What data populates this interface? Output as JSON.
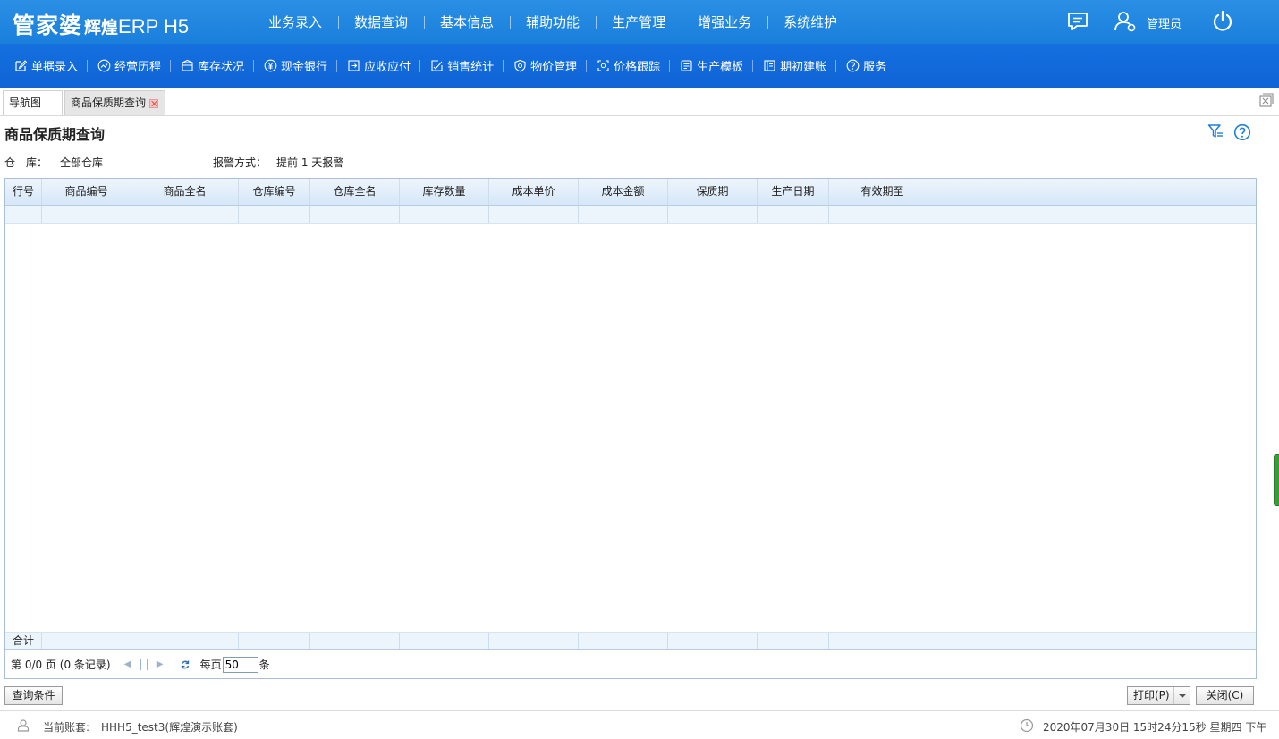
{
  "header": {
    "logo_main": "管家婆",
    "logo_sub": "辉煌",
    "logo_erp": "ERP H5",
    "nav": [
      "业务录入",
      "数据查询",
      "基本信息",
      "辅助功能",
      "生产管理",
      "增强业务",
      "系统维护"
    ],
    "user": "管理员",
    "icons": [
      "message-icon",
      "user-icon",
      "power-icon"
    ]
  },
  "subnav": [
    {
      "label": "单据录入",
      "icon": "edit-icon"
    },
    {
      "label": "经营历程",
      "icon": "trend-icon"
    },
    {
      "label": "库存状况",
      "icon": "warehouse-icon"
    },
    {
      "label": "现金银行",
      "icon": "yuan-icon"
    },
    {
      "label": "应收应付",
      "icon": "ledger-icon"
    },
    {
      "label": "销售统计",
      "icon": "checklist-icon"
    },
    {
      "label": "物价管理",
      "icon": "shield-icon"
    },
    {
      "label": "价格跟踪",
      "icon": "scan-icon"
    },
    {
      "label": "生产模板",
      "icon": "template-icon"
    },
    {
      "label": "期初建账",
      "icon": "book-icon"
    },
    {
      "label": "服务",
      "icon": "help-circle-icon"
    }
  ],
  "tabs": [
    {
      "label": "导航图"
    },
    {
      "label": "商品保质期查询",
      "active": true
    }
  ],
  "page": {
    "title": "商品保质期查询",
    "warehouse_label": "仓　库：",
    "warehouse_value": "全部仓库",
    "alert_label": "报警方式：",
    "alert_value": "提前 1 天报警"
  },
  "grid": {
    "columns": [
      "行号",
      "商品编号",
      "商品全名",
      "仓库编号",
      "仓库全名",
      "库存数量",
      "成本单价",
      "成本金额",
      "保质期",
      "生产日期",
      "有效期至"
    ],
    "rows": [],
    "total_label": "合计"
  },
  "pager": {
    "page_info": "第 0/0 页 (0 条记录)",
    "per_page_label": "每页",
    "per_page_value": "50",
    "per_page_unit": "条"
  },
  "buttons": {
    "query": "查询条件",
    "print": "打印(P)",
    "close": "关闭(C)"
  },
  "status": {
    "account_label": "当前账套:",
    "account_value": "HHH5_test3(辉煌演示账套)",
    "datetime": "2020年07月30日 15时24分15秒 星期四 下午"
  },
  "colors": {
    "top_bar": "#1a84dd",
    "sub_bar": "#1268da",
    "grid_header": "#d6e7f8",
    "accent_icon": "#1f7fd6"
  }
}
